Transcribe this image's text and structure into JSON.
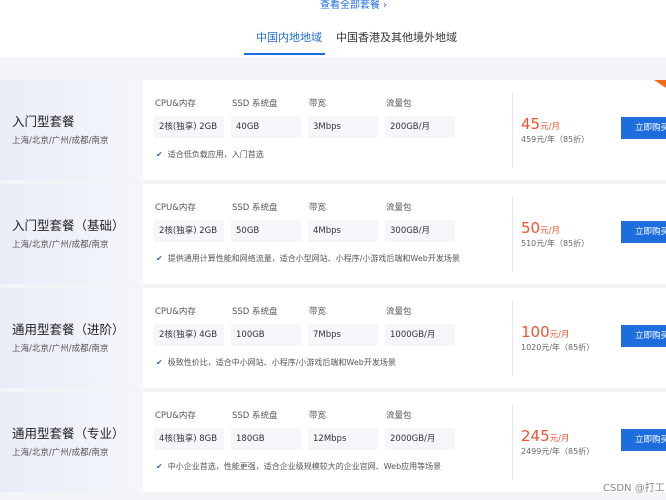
{
  "top_link": {
    "label": "查看全部套餐"
  },
  "tabs": [
    {
      "label": "中国内地地域",
      "active": true
    },
    {
      "label": "中国香港及其他境外地域",
      "active": false
    }
  ],
  "spec_headers": [
    "CPU&内存",
    "SSD 系统盘",
    "带宽",
    "流量包"
  ],
  "packages": [
    {
      "name": "入门型套餐",
      "regions": "上海/北京/广州/成都/南京",
      "specs": [
        "2核(独享) 2GB",
        "40GB",
        "3Mbps",
        "200GB/月"
      ],
      "feature": "适合低负载应用，入门首选",
      "price": "45",
      "price_unit": "元/月",
      "yearly": "459元/年（85折）",
      "buy_label": "立即购买"
    },
    {
      "name": "入门型套餐（基础）",
      "regions": "上海/北京/广州/成都/南京",
      "specs": [
        "2核(独享) 2GB",
        "50GB",
        "4Mbps",
        "300GB/月"
      ],
      "feature": "提供通用计算性能和网络流量，适合小型网站、小程序/小游戏后端和Web开发场景",
      "price": "50",
      "price_unit": "元/月",
      "yearly": "510元/年（85折）",
      "buy_label": "立即购买"
    },
    {
      "name": "通用型套餐（进阶）",
      "regions": "上海/北京/广州/成都/南京",
      "specs": [
        "2核(独享) 4GB",
        "100GB",
        "7Mbps",
        "1000GB/月"
      ],
      "feature": "极致性价比，适合中小网站、小程序/小游戏后端和Web开发场景",
      "price": "100",
      "price_unit": "元/月",
      "yearly": "1020元/年（85折）",
      "buy_label": "立即购买"
    },
    {
      "name": "通用型套餐（专业）",
      "regions": "上海/北京/广州/成都/南京",
      "specs": [
        "4核(独享) 8GB",
        "180GB",
        "12Mbps",
        "2000GB/月"
      ],
      "feature": "中小企业首选，性能更强，适合企业级规模较大的企业官网、Web应用等场景",
      "price": "245",
      "price_unit": "元/月",
      "yearly": "2499元/年（85折）",
      "buy_label": "立即购买"
    }
  ],
  "watermark": "CSDN @打工",
  "colors": {
    "accent": "#1e6dde",
    "price": "#f3522d",
    "corner": "#f46b1a"
  },
  "icons": {
    "chevron": "chevron-right-icon",
    "check": "check-icon",
    "corner": "corner-tag-icon"
  }
}
